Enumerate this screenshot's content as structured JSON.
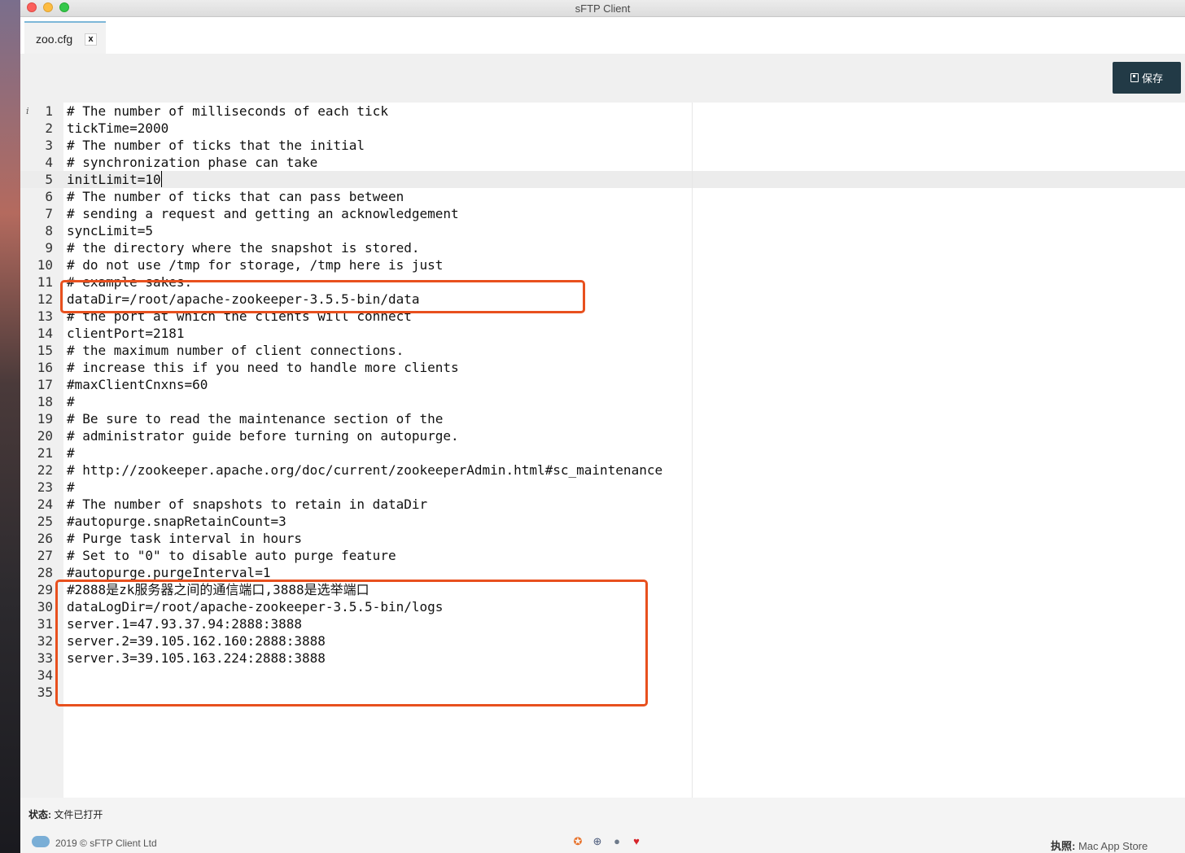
{
  "window": {
    "title": "sFTP Client"
  },
  "tabs": [
    {
      "label": "zoo.cfg",
      "close_label": "x"
    }
  ],
  "toolbar": {
    "save_label": "保存"
  },
  "editor": {
    "info_marker": "i",
    "active_line": 5,
    "lines": [
      "# The number of milliseconds of each tick",
      "tickTime=2000",
      "# The number of ticks that the initial",
      "# synchronization phase can take",
      "initLimit=10",
      "# The number of ticks that can pass between",
      "# sending a request and getting an acknowledgement",
      "syncLimit=5",
      "# the directory where the snapshot is stored.",
      "# do not use /tmp for storage, /tmp here is just",
      "# example sakes.",
      "dataDir=/root/apache-zookeeper-3.5.5-bin/data",
      "# the port at which the clients will connect",
      "clientPort=2181",
      "# the maximum number of client connections.",
      "# increase this if you need to handle more clients",
      "#maxClientCnxns=60",
      "#",
      "# Be sure to read the maintenance section of the",
      "# administrator guide before turning on autopurge.",
      "#",
      "# http://zookeeper.apache.org/doc/current/zookeeperAdmin.html#sc_maintenance",
      "#",
      "# The number of snapshots to retain in dataDir",
      "#autopurge.snapRetainCount=3",
      "# Purge task interval in hours",
      "# Set to \"0\" to disable auto purge feature",
      "#autopurge.purgeInterval=1",
      "#2888是zk服务器之间的通信端口,3888是选举端口",
      "dataLogDir=/root/apache-zookeeper-3.5.5-bin/logs",
      "server.1=47.93.37.94:2888:3888",
      "server.2=39.105.162.160:2888:3888",
      "server.3=39.105.163.224:2888:3888",
      "",
      ""
    ]
  },
  "status": {
    "label": "状态:",
    "value": "文件已打开"
  },
  "footer": {
    "copyright": "2019 © sFTP Client Ltd",
    "platform_label": "执照:",
    "platform_value": "Mac App Store",
    "icons": [
      "help-icon",
      "globe-icon",
      "chat-icon",
      "heart-icon"
    ]
  },
  "colors": {
    "accent": "#223a46",
    "highlight_box": "#e8501e",
    "tab_border": "#7db7d8"
  }
}
